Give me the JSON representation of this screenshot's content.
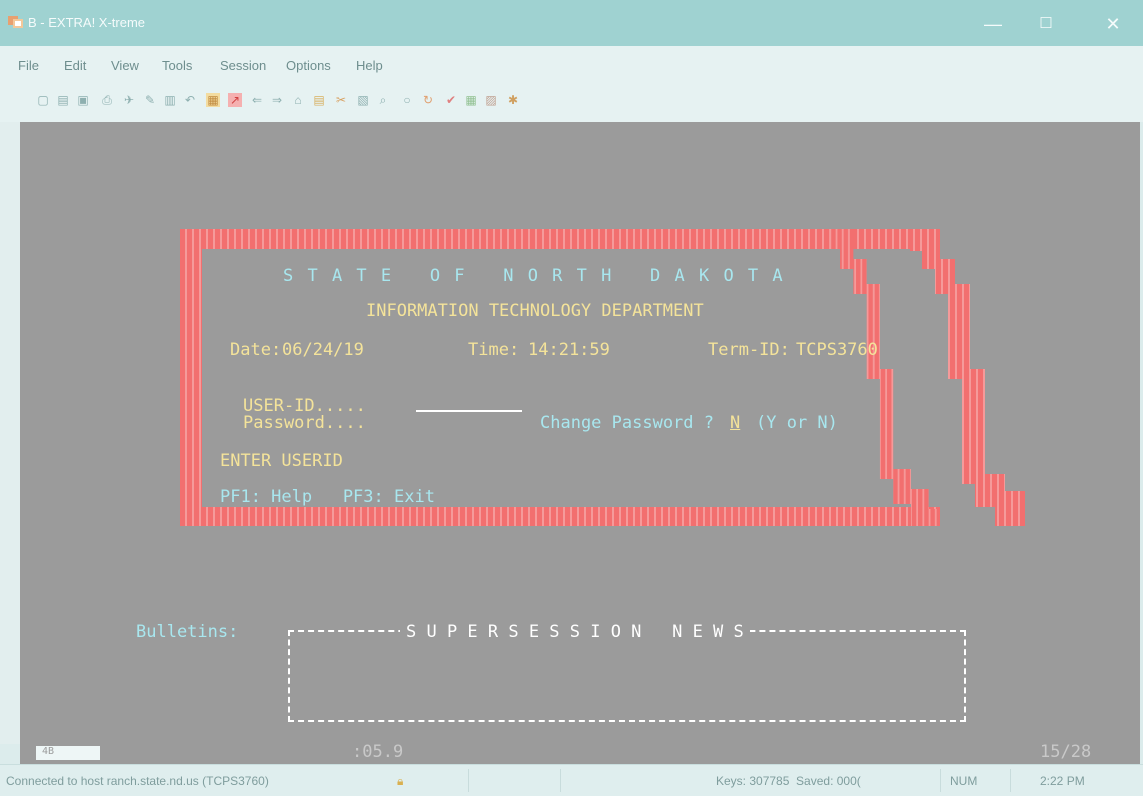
{
  "window": {
    "title": "B - EXTRA! X-treme",
    "minimize": "—",
    "maximize": "☐",
    "close": "✕"
  },
  "menu": [
    {
      "label": "File",
      "key": "F"
    },
    {
      "label": "Edit",
      "key": "E"
    },
    {
      "label": "View",
      "key": "V"
    },
    {
      "label": "Tools",
      "key": "T"
    },
    {
      "label": "Session",
      "key": "S"
    },
    {
      "label": "Options",
      "key": "O"
    },
    {
      "label": "Help",
      "key": "H"
    }
  ],
  "toolbar_icons": [
    "new-icon",
    "open-icon",
    "save-icon",
    "print-icon",
    "send-icon",
    "edit-icon",
    "copy-icon",
    "undo-icon",
    "macro-icon",
    "record-icon",
    "back-icon",
    "forward-icon",
    "home-icon",
    "chart-icon",
    "tools-icon",
    "paste-icon",
    "view-icon",
    "circle-icon",
    "refresh-icon",
    "check-icon",
    "grid-icon",
    "graph-icon",
    "help-icon"
  ],
  "terminal": {
    "state_title": "S T A T E   O F   N O R T H   D A K O T A",
    "dept": "INFORMATION TECHNOLOGY DEPARTMENT",
    "date_label": "Date:",
    "date_value": "06/24/19",
    "time_label": "Time:",
    "time_value": "14:21:59",
    "termid_label": "Term-ID:",
    "termid_value": "TCPS3760",
    "userid_label": "USER-ID.....",
    "userid_value": "",
    "password_label": "Password....",
    "change_pw_label": "Change Password ?",
    "change_pw_value": "N",
    "change_pw_hint": "(Y or N)",
    "message": "ENTER USERID",
    "pf_keys": "PF1: Help   PF3: Exit",
    "bulletins_label": "Bulletins:",
    "bulletins_title": "S U P E R S E S S I O N   N E W S",
    "bottom_left": "4B",
    "timer": ":05.9",
    "cursor_pos": "15/28"
  },
  "statusbar": {
    "connection": "Connected to host ranch.state.nd.us (TCPS3760)",
    "keys": "Keys: 307785  Saved: 000(",
    "num": "NUM",
    "time": "2:22 PM"
  },
  "colors": {
    "terminal_bg": "#9b9b9b",
    "border_red": "#f26f6f",
    "text_yellow": "#f4e39a",
    "text_cyan": "#a8e7ef",
    "text_white": "#ffffff"
  }
}
